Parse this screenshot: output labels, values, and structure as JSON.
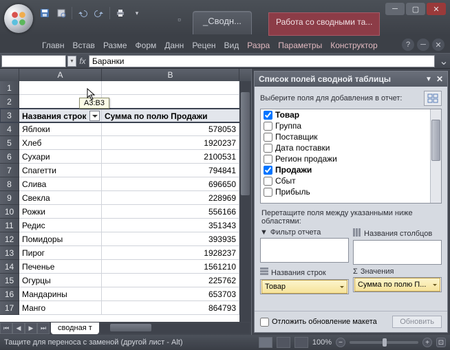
{
  "qat": {
    "icons": [
      "save",
      "print-preview",
      "undo",
      "redo",
      "quick-print",
      "more"
    ]
  },
  "doc_title": "_Сводн...",
  "context_tab": "Работа со сводными та...",
  "ribbon": {
    "tabs": [
      "Главн",
      "Встав",
      "Разме",
      "Форм",
      "Данн",
      "Рецен",
      "Вид"
    ],
    "ctx_tabs": [
      "Разра",
      "Параметры",
      "Конструктор"
    ]
  },
  "name_box": "",
  "formula": "Баранки",
  "columns": [
    "A",
    "B"
  ],
  "pivot_headers": {
    "a": "Названия строк",
    "b": "Сумма по полю Продажи"
  },
  "rows": [
    {
      "n": 1,
      "a": "",
      "b": ""
    },
    {
      "n": 2,
      "a": "",
      "b": ""
    },
    {
      "n": 3,
      "hdr": true
    },
    {
      "n": 4,
      "a": "Яблоки",
      "b": "578053"
    },
    {
      "n": 5,
      "a": "Хлеб",
      "b": "1920237"
    },
    {
      "n": 6,
      "a": "Сухари",
      "b": "2100531"
    },
    {
      "n": 7,
      "a": "Спагетти",
      "b": "794841"
    },
    {
      "n": 8,
      "a": "Слива",
      "b": "696650"
    },
    {
      "n": 9,
      "a": "Свекла",
      "b": "228969"
    },
    {
      "n": 10,
      "a": "Рожки",
      "b": "556166"
    },
    {
      "n": 11,
      "a": "Редис",
      "b": "351343"
    },
    {
      "n": 12,
      "a": "Помидоры",
      "b": "393935"
    },
    {
      "n": 13,
      "a": "Пирог",
      "b": "1928237"
    },
    {
      "n": 14,
      "a": "Печенье",
      "b": "1561210"
    },
    {
      "n": 15,
      "a": "Огурцы",
      "b": "225762"
    },
    {
      "n": 16,
      "a": "Мандарины",
      "b": "653703"
    },
    {
      "n": 17,
      "a": "Манго",
      "b": "864793"
    }
  ],
  "range_tip": "A3:B3",
  "sheet_tab": "сводная т",
  "pane": {
    "title": "Список полей сводной таблицы",
    "subtitle": "Выберите поля для добавления в отчет:",
    "fields": [
      {
        "label": "Товар",
        "checked": true
      },
      {
        "label": "Группа",
        "checked": false
      },
      {
        "label": "Поставщик",
        "checked": false
      },
      {
        "label": "Дата поставки",
        "checked": false
      },
      {
        "label": "Регион продажи",
        "checked": false
      },
      {
        "label": "Продажи",
        "checked": true
      },
      {
        "label": "Сбыт",
        "checked": false
      },
      {
        "label": "Прибыль",
        "checked": false
      }
    ],
    "areas_label": "Перетащите поля между указанными ниже областями:",
    "areas": {
      "filter": "Фильтр отчета",
      "cols": "Названия столбцов",
      "rows": "Названия строк",
      "vals": "Значения",
      "row_pill": "Товар",
      "val_pill": "Сумма по полю П..."
    },
    "defer": "Отложить обновление макета",
    "update": "Обновить"
  },
  "status": {
    "text": "Тащите для переноса с заменой (другой лист - Alt)",
    "zoom": "100%"
  }
}
